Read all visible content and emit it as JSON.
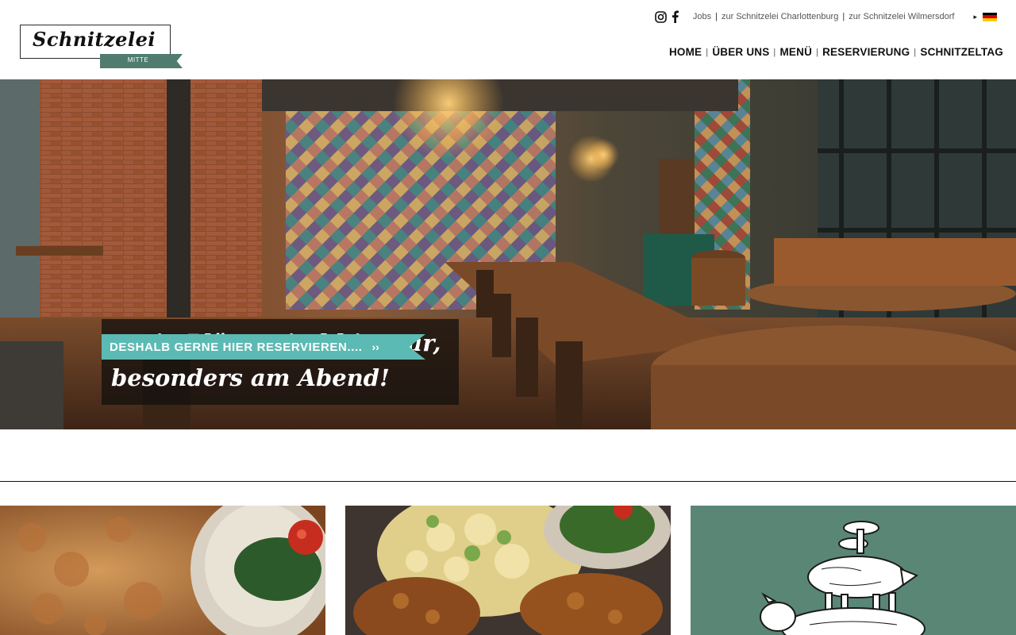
{
  "header": {
    "logo": {
      "name": "Schnitzelei",
      "location": "MITTE"
    },
    "social": [
      {
        "icon": "instagram-icon"
      },
      {
        "icon": "facebook-icon"
      }
    ],
    "top_links": [
      "Jobs",
      "zur Schnitzelei Charlottenburg",
      "zur Schnitzelei Wilmersdorf"
    ],
    "separator": "|",
    "language": {
      "arrow": "▸",
      "icon": "german-flag-icon",
      "colors": [
        "#000000",
        "#dd0000",
        "#ffcc00"
      ]
    },
    "nav": [
      "HOME",
      "ÜBER UNS",
      "MENÜ",
      "RESERVIERUNG",
      "SCHNITZELTAG"
    ]
  },
  "hero": {
    "headline": "Freie Plätze sind hier rar, besonders am Abend!",
    "cta_label": "DESHALB GERNE HIER RESERVIEREN....",
    "cta_arrow": "››",
    "colors": {
      "cta": "#5bbab3",
      "caption_bg": "#14110e"
    }
  },
  "cards": [
    {
      "image": "schnitzel-with-salad-bowl-photo"
    },
    {
      "image": "schnitzel-with-potato-salad-photo"
    },
    {
      "image": "pig-and-cow-illustration",
      "background": "#5a8676"
    }
  ],
  "brand": {
    "accent": "#4f7c6f",
    "teal": "#5bbab3"
  }
}
